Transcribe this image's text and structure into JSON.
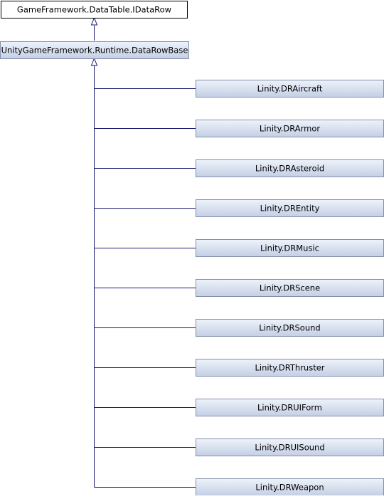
{
  "root": {
    "label": "GameFramework.DataTable.IDataRow"
  },
  "base": {
    "label": "UnityGameFramework.Runtime.DataRowBase"
  },
  "derived": [
    {
      "label": "Linity.DRAircraft"
    },
    {
      "label": "Linity.DRArmor"
    },
    {
      "label": "Linity.DRAsteroid"
    },
    {
      "label": "Linity.DREntity"
    },
    {
      "label": "Linity.DRMusic"
    },
    {
      "label": "Linity.DRScene"
    },
    {
      "label": "Linity.DRSound"
    },
    {
      "label": "Linity.DRThruster"
    },
    {
      "label": "Linity.DRUIForm"
    },
    {
      "label": "Linity.DRUISound"
    },
    {
      "label": "Linity.DRWeapon"
    }
  ],
  "colors": {
    "edge": "#191970",
    "root_fill": "#ffffff",
    "root_border": "#000000",
    "node_fill_top": "#eef3fa",
    "node_fill_bottom": "#c4cfe5",
    "node_border": "#848ea8"
  }
}
